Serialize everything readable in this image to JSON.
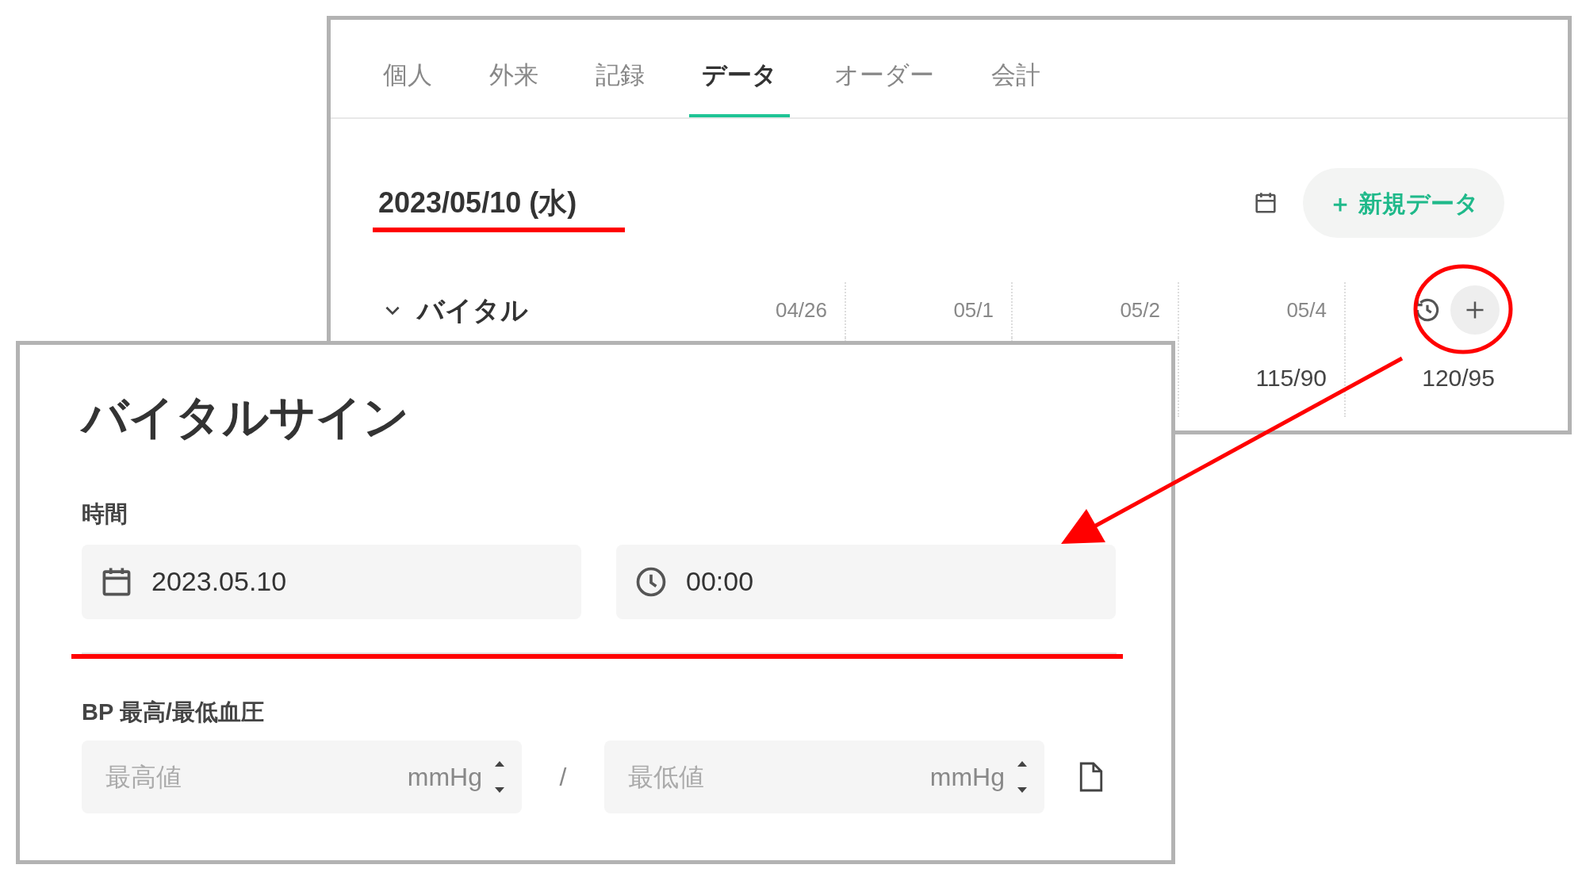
{
  "record_window": {
    "tabs": [
      {
        "label": "個人",
        "selected": false
      },
      {
        "label": "外来",
        "selected": false
      },
      {
        "label": "記録",
        "selected": false
      },
      {
        "label": "データ",
        "selected": true
      },
      {
        "label": "オーダー",
        "selected": false
      },
      {
        "label": "会計",
        "selected": false
      }
    ],
    "date_header": "2023/05/10 (水)",
    "new_data_button": "＋ 新規データ",
    "section": {
      "title": "バイタル",
      "expanded": true,
      "columns": [
        "04/26",
        "05/1",
        "05/2",
        "05/4"
      ],
      "visible_readings": [
        "115/90",
        "120/95"
      ]
    }
  },
  "vital_dialog": {
    "title": "バイタルサイン",
    "time": {
      "label": "時間",
      "date_value": "2023.05.10",
      "time_value": "00:00"
    },
    "bp": {
      "label": "BP 最高/最低血圧",
      "high": {
        "placeholder": "最高値",
        "unit": "mmHg"
      },
      "separator": "/",
      "low": {
        "placeholder": "最低値",
        "unit": "mmHg"
      }
    }
  }
}
